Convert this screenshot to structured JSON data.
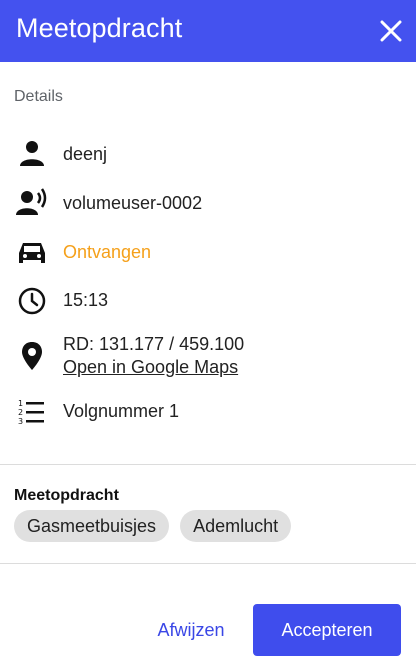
{
  "header": {
    "title": "Meetopdracht"
  },
  "details": {
    "label": "Details",
    "user": "deenj",
    "volume_user": "volumeuser-0002",
    "status": "Ontvangen",
    "time": "15:13",
    "rd": "RD: 131.177 / 459.100",
    "maps_link": "Open in Google Maps",
    "sequence": "Volgnummer 1"
  },
  "assignment": {
    "title": "Meetopdracht",
    "chips": [
      "Gasmeetbuisjes",
      "Ademlucht"
    ]
  },
  "actions": {
    "reject": "Afwijzen",
    "accept": "Accepteren"
  },
  "colors": {
    "header": "#4452ef",
    "status": "#f5a01a",
    "link": "#1a1adb",
    "primary": "#3f4ded"
  }
}
